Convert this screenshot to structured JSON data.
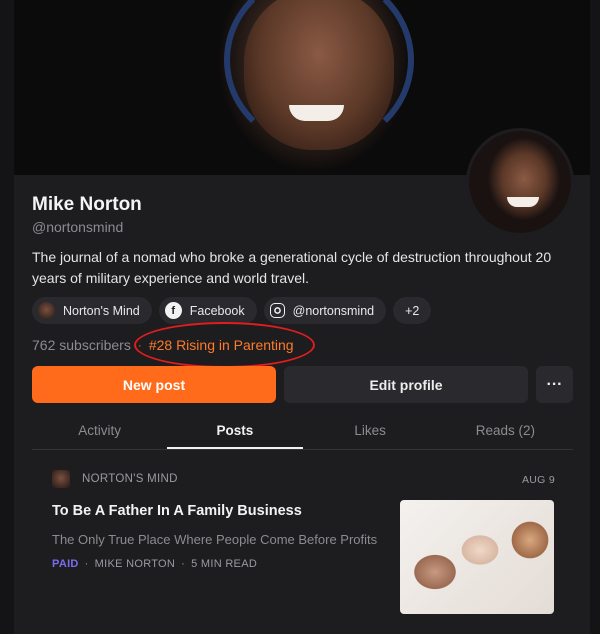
{
  "profile": {
    "name": "Mike Norton",
    "handle": "@nortonsmind",
    "bio": "The journal of a nomad who broke a generational cycle of destruction throughout 20 years of military experience and world travel."
  },
  "links": [
    {
      "label": "Norton's Mind",
      "icon": "publication-avatar-icon"
    },
    {
      "label": "Facebook",
      "icon": "facebook-icon"
    },
    {
      "label": "@nortonsmind",
      "icon": "instagram-icon"
    },
    {
      "label": "+2",
      "icon": ""
    }
  ],
  "stats": {
    "subscribers": "762 subscribers",
    "separator": "·",
    "rank": "#28 Rising in Parenting"
  },
  "actions": {
    "new_post": "New post",
    "edit_profile": "Edit profile",
    "more": "···"
  },
  "tabs": [
    {
      "label": "Activity",
      "active": false
    },
    {
      "label": "Posts",
      "active": true
    },
    {
      "label": "Likes",
      "active": false
    },
    {
      "label": "Reads (2)",
      "active": false
    }
  ],
  "post": {
    "publication": "NORTON'S MIND",
    "date": "AUG 9",
    "title": "To Be A Father In A Family Business",
    "subtitle": "The Only True Place Where People Come Before Profits",
    "paid": "PAID",
    "author": "MIKE NORTON",
    "read_time": "5 MIN READ",
    "separator": "·"
  },
  "colors": {
    "accent": "#ff6b1a",
    "rank_text": "#ff7a29",
    "paid": "#7c6cf0",
    "highlight_ring": "#e11d1d"
  }
}
